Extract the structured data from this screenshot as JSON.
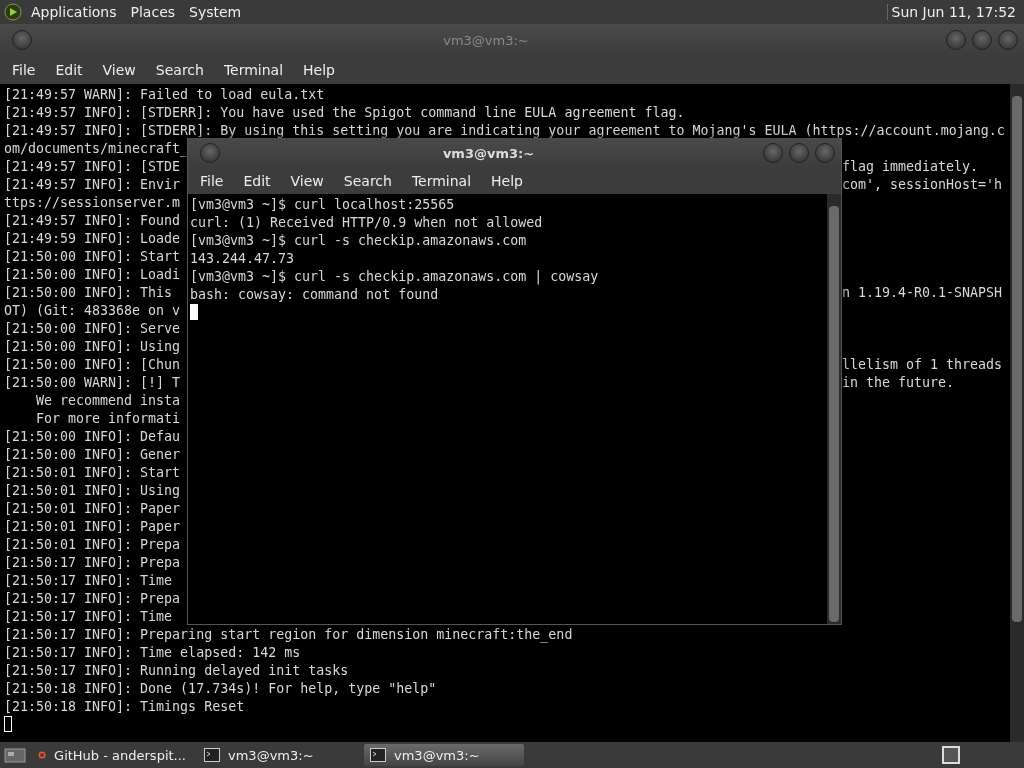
{
  "top_panel": {
    "menus": [
      "Applications",
      "Places",
      "System"
    ],
    "clock": "Sun Jun 11, 17:52"
  },
  "back_window": {
    "title": "vm3@vm3:~",
    "menu": [
      "File",
      "Edit",
      "View",
      "Search",
      "Terminal",
      "Help"
    ],
    "lines": [
      {
        "text": "[21:49:57 WARN]: Failed to load eula.txt"
      },
      {
        "text": "[21:49:57 INFO]: [STDERR]: You have used the Spigot command line EULA agreement flag."
      },
      {
        "text": "[21:49:57 INFO]: [STDERR]: By using this setting you are indicating your agreement to Mojang's EULA (https://account.mojang.c"
      },
      {
        "text": "om/documents/minecraft_"
      },
      {
        "text": "[21:49:57 INFO]: [STDE",
        "right": "flag immediately."
      },
      {
        "text": "[21:49:57 INFO]: Envir",
        "right": "com', sessionHost='h"
      },
      {
        "text": "ttps://sessionserver.m"
      },
      {
        "text": "[21:49:57 INFO]: Found"
      },
      {
        "text": "[21:49:59 INFO]: Loade"
      },
      {
        "text": "[21:50:00 INFO]: Start"
      },
      {
        "text": "[21:50:00 INFO]: Loadi"
      },
      {
        "text": "[21:50:00 INFO]: This",
        "right": "n 1.19.4-R0.1-SNAPSH"
      },
      {
        "text": "OT) (Git: 483368e on v"
      },
      {
        "text": "[21:50:00 INFO]: Serve"
      },
      {
        "text": "[21:50:00 INFO]: Using"
      },
      {
        "text": "[21:50:00 INFO]: [Chun",
        "right": "llelism of 1 threads"
      },
      {
        "text": "[21:50:00 WARN]: [!] T",
        "right": "in the future."
      },
      {
        "text": "    We recommend insta"
      },
      {
        "text": "    For more informati"
      },
      {
        "text": "[21:50:00 INFO]: Defau"
      },
      {
        "text": "[21:50:00 INFO]: Gener"
      },
      {
        "text": "[21:50:01 INFO]: Start"
      },
      {
        "text": "[21:50:01 INFO]: Using"
      },
      {
        "text": "[21:50:01 INFO]: Paper"
      },
      {
        "text": "[21:50:01 INFO]: Paper"
      },
      {
        "text": "[21:50:01 INFO]: Prepa"
      },
      {
        "text": "[21:50:17 INFO]: Prepa"
      },
      {
        "text": "[21:50:17 INFO]: Time"
      },
      {
        "text": "[21:50:17 INFO]: Prepa"
      },
      {
        "text": "[21:50:17 INFO]: Time"
      },
      {
        "text": "[21:50:17 INFO]: Preparing start region for dimension minecraft:the_end"
      },
      {
        "text": "[21:50:17 INFO]: Time elapsed: 142 ms"
      },
      {
        "text": "[21:50:17 INFO]: Running delayed init tasks"
      },
      {
        "text": "[21:50:18 INFO]: Done (17.734s)! For help, type \"help\""
      },
      {
        "text": "[21:50:18 INFO]: Timings Reset"
      }
    ]
  },
  "front_window": {
    "title": "vm3@vm3:~",
    "menu": [
      "File",
      "Edit",
      "View",
      "Search",
      "Terminal",
      "Help"
    ],
    "lines": [
      {
        "text": "[vm3@vm3 ~]$ curl localhost:25565"
      },
      {
        "text": "curl: (1) Received HTTP/0.9 when not allowed"
      },
      {
        "text": "[vm3@vm3 ~]$ curl -s checkip.amazonaws.com"
      },
      {
        "text": "143.244.47.73"
      },
      {
        "text": "[vm3@vm3 ~]$ curl -s checkip.amazonaws.com | cowsay"
      },
      {
        "text": "bash: cowsay: command not found"
      }
    ]
  },
  "taskbar": {
    "items": [
      {
        "kind": "browser",
        "label": "GitHub - anderspit...",
        "selected": false
      },
      {
        "kind": "terminal",
        "label": "vm3@vm3:~",
        "selected": false
      },
      {
        "kind": "terminal",
        "label": "vm3@vm3:~",
        "selected": true
      }
    ]
  }
}
